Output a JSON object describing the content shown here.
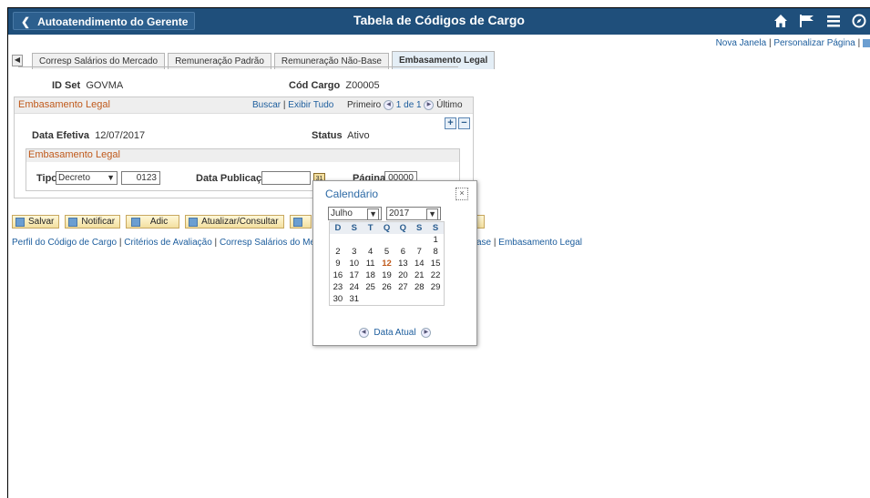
{
  "header": {
    "back_label": "Autoatendimento do Gerente",
    "title": "Tabela de Códigos de Cargo",
    "icons": [
      "home-icon",
      "flag-icon",
      "menu-icon",
      "compass-icon"
    ]
  },
  "toplinks": {
    "new_window": "Nova Janela",
    "sep": "|",
    "personalize": "Personalizar Página",
    "sep2": "|"
  },
  "tabs": [
    {
      "label": "Corresp Salários do Mercado"
    },
    {
      "label": "Remuneração Padrão"
    },
    {
      "label": "Remuneração Não-Base"
    },
    {
      "label": "Embasamento Legal"
    }
  ],
  "ids": {
    "setid_label": "ID Set",
    "setid_value": "GOVMA",
    "jobcode_label": "Cód Cargo",
    "jobcode_value": "Z00005"
  },
  "group1": {
    "title": "Embasamento Legal",
    "find": "Buscar",
    "sep": "|",
    "view_all": "Exibir Tudo",
    "first": "Primeiro",
    "counter": "1 de 1",
    "last": "Último",
    "eff_label": "Data Efetiva",
    "eff_value": "12/07/2017",
    "status_label": "Status",
    "status_value": "Ativo"
  },
  "group2": {
    "title": "Embasamento Legal",
    "type_label": "Tipo",
    "type_value": "Decreto",
    "number_value": "0123",
    "pubdate_label": "Data Publicação",
    "pubdate_value": "",
    "page_label": "Página",
    "page_value": "00000"
  },
  "toolbar": {
    "save": "Salvar",
    "notify": "Notificar",
    "add": "Adic",
    "update": "Atualizar/Consultar"
  },
  "pagelinks": {
    "a": "Perfil do Código de Cargo",
    "b": "Critérios de Avaliação",
    "c": "Corresp Salários do Mercado",
    "d": "ase",
    "e": "Embasamento Legal",
    "sep": " | "
  },
  "calendar": {
    "title": "Calendário",
    "close": "×",
    "month": "Julho",
    "year": "2017",
    "weekdays": [
      "D",
      "S",
      "T",
      "Q",
      "Q",
      "S",
      "S"
    ],
    "weeks": [
      [
        "",
        "",
        "",
        "",
        "",
        "",
        "1"
      ],
      [
        "2",
        "3",
        "4",
        "5",
        "6",
        "7",
        "8"
      ],
      [
        "9",
        "10",
        "11",
        "12",
        "13",
        "14",
        "15"
      ],
      [
        "16",
        "17",
        "18",
        "19",
        "20",
        "21",
        "22"
      ],
      [
        "23",
        "24",
        "25",
        "26",
        "27",
        "28",
        "29"
      ],
      [
        "30",
        "31",
        "",
        "",
        "",
        "",
        ""
      ]
    ],
    "today": "12",
    "footer": "Data Atual"
  },
  "colors": {
    "header_bg": "#1f4f7b",
    "accent_orange": "#c05a1c",
    "link_blue": "#1c5d9d"
  }
}
